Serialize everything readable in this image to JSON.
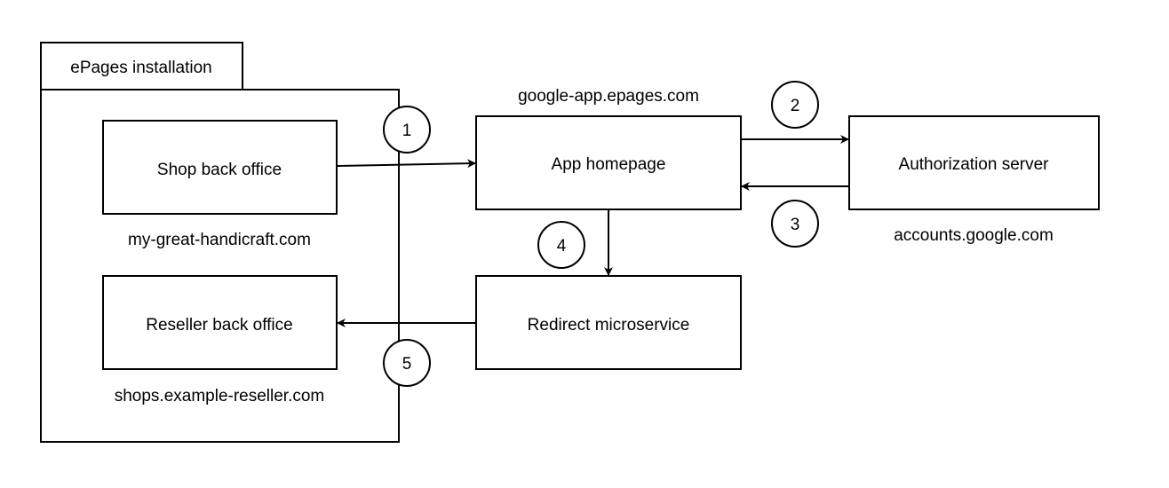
{
  "container": {
    "tab_label": "ePages installation"
  },
  "nodes": {
    "shop": {
      "label": "Shop back office",
      "domain": "my-great-handicraft.com"
    },
    "reseller": {
      "label": "Reseller back office",
      "domain": "shops.example-reseller.com"
    },
    "app": {
      "label": "App homepage",
      "domain": "google-app.epages.com"
    },
    "auth": {
      "label": "Authorization server",
      "domain": "accounts.google.com"
    },
    "redirect": {
      "label": "Redirect microservice"
    }
  },
  "steps": [
    "1",
    "2",
    "3",
    "4",
    "5"
  ]
}
